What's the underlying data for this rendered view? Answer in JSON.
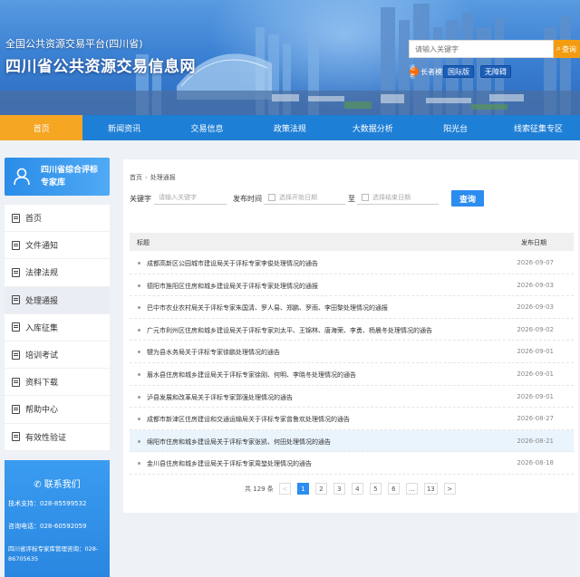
{
  "header": {
    "subtitle": "全国公共资源交易平台(四川省)",
    "title": "四川省公共资源交易信息网",
    "search_placeholder": "请输入关键字",
    "search_button": "查询",
    "age_icon": "适老",
    "age_label": "长者模式",
    "link_english": "国际版",
    "link_barrier_free": "无障碍"
  },
  "nav": {
    "items": [
      "首页",
      "新闻资讯",
      "交易信息",
      "政策法规",
      "大数据分析",
      "阳光台",
      "线索征集专区"
    ],
    "active_index": 0
  },
  "sidebar": {
    "expert_card_line1": "四川省综合评标",
    "expert_card_line2": "专家库",
    "menu": [
      "首页",
      "文件通知",
      "法律法规",
      "处理通报",
      "入库征集",
      "培训考试",
      "资料下载",
      "帮助中心",
      "有效性验证"
    ],
    "active_index": 3,
    "contact_title": "联系我们",
    "contact_lines": [
      "技术支持：028-85599532",
      "咨询电话：028-60592059",
      "四川省评标专家库管理咨询：028-86705635"
    ]
  },
  "main": {
    "breadcrumb_home": "首页",
    "breadcrumb_current": "处理通报",
    "filter": {
      "keyword_label": "关键字",
      "keyword_placeholder": "请输入关键字",
      "time_label": "发布时间",
      "start_placeholder": "选择开始日期",
      "range_sep": "至",
      "end_placeholder": "选择结束日期",
      "query_button": "查询"
    },
    "table": {
      "col_title": "标题",
      "col_date": "发布日期",
      "rows": [
        {
          "title": "成都高新区公园城市建设局关于评标专家李俊处理情况的通告",
          "date": "2026-09-07"
        },
        {
          "title": "德阳市旌阳区住房和城乡建设局关于评标专家处理情况的通报",
          "date": "2026-09-03"
        },
        {
          "title": "巴中市农业农村局关于评标专家朱国清、罗人易、郑鹏、罗雨、李田黎处理情况的通报",
          "date": "2026-09-03"
        },
        {
          "title": "广元市利州区住房和城乡建设局关于评标专家刘太平、王锦林、唐海荣、李勇、杨晨冬处理情况的通告",
          "date": "2026-09-02"
        },
        {
          "title": "犍为县水务局关于评标专家徐鹏处理情况的通告",
          "date": "2026-09-01"
        },
        {
          "title": "眉水县住房和城乡建设局关于评标专家徐刚、何明、李晓冬处理情况的通告",
          "date": "2026-09-01"
        },
        {
          "title": "泸县发展和改革局关于评标专家郭强处理情况的通告",
          "date": "2026-09-01"
        },
        {
          "title": "成都市新津区住房建设和交通运输局关于评标专家曾鲁欢处理情况的通告",
          "date": "2026-08-27"
        },
        {
          "title": "绵阳市住房和城乡建设局关于评标专家张凯、何田处理情况的通告",
          "date": "2026-08-21"
        },
        {
          "title": "金川县住房和城乡建设局关于评标专家周堃处理情况的通告",
          "date": "2026-08-18"
        }
      ],
      "highlight_index": 8
    },
    "pager": {
      "total_text": "共 129 条",
      "prev": "<",
      "pages": [
        "1",
        "2",
        "3",
        "4",
        "5",
        "6",
        "…",
        "13"
      ],
      "next": ">",
      "active": "1"
    }
  },
  "colors": {
    "nav_bg": "#1e7fd6",
    "nav_active": "#f5a623",
    "accent": "#2d8cf0",
    "search_button": "#f39c12"
  }
}
